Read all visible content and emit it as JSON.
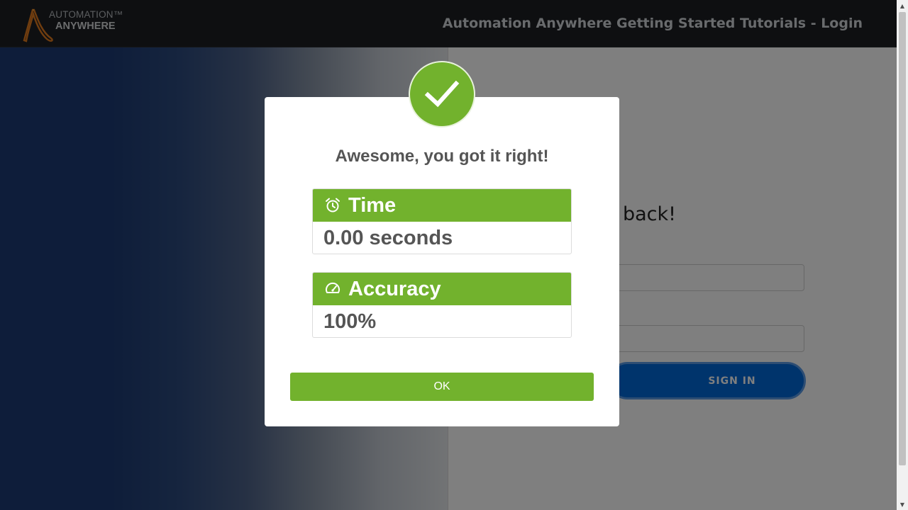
{
  "header": {
    "logo_line1": "AUTOMATION™",
    "logo_line2": "ANYWHERE",
    "title": "Automation Anywhere Getting Started Tutorials - Login"
  },
  "login": {
    "welcome_text": "back!",
    "signin_label": "SIGN IN"
  },
  "modal": {
    "title": "Awesome, you got it right!",
    "time_label": "Time",
    "time_value": "0.00 seconds",
    "accuracy_label": "Accuracy",
    "accuracy_value": "100%",
    "ok_label": "OK"
  },
  "icons": {
    "success": "checkmark-icon",
    "time": "alarm-clock-icon",
    "accuracy": "speedometer-icon"
  },
  "colors": {
    "accent_green": "#72b22d",
    "navbar_bg": "#1c1f23",
    "primary_blue": "#0069d9"
  }
}
